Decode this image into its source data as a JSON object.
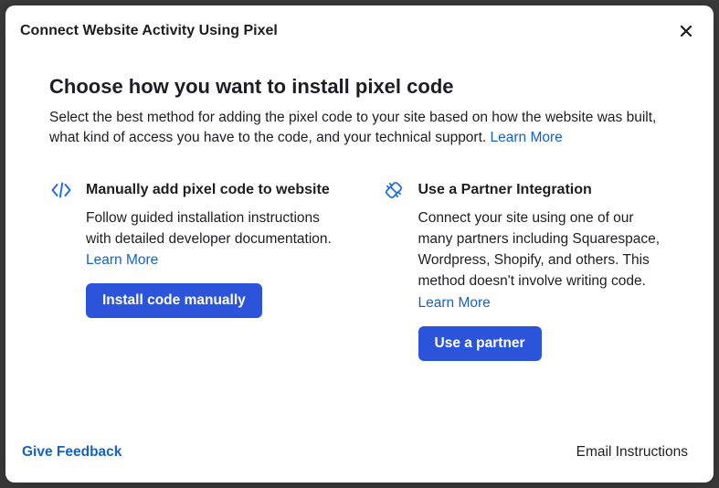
{
  "header": {
    "title": "Connect Website Activity Using Pixel"
  },
  "section": {
    "title": "Choose how you want to install pixel code",
    "desc": "Select the best method for adding the pixel code to your site based on how the website was built, what kind of access you have to the code, and your technical support. ",
    "learn_more": "Learn More"
  },
  "options": {
    "manual": {
      "title": "Manually add pixel code to website",
      "desc": "Follow guided installation instructions with detailed developer documentation. ",
      "learn_more": "Learn More",
      "button": "Install code manually"
    },
    "partner": {
      "title": "Use a Partner Integration",
      "desc": "Connect your site using one of our many partners including Squarespace, Wordpress, Shopify, and others. This method doesn't involve writing code. ",
      "learn_more": "Learn More",
      "button": "Use a partner"
    }
  },
  "footer": {
    "feedback": "Give Feedback",
    "email": "Email Instructions"
  }
}
